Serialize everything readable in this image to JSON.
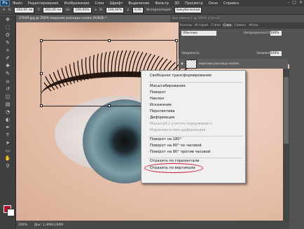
{
  "menubar": {
    "logo": "Ps",
    "items": [
      "Файл",
      "Редактирование",
      "Изображение",
      "Слои",
      "Шрифт",
      "Выделение",
      "Фильтр",
      "3D",
      "Просмотр",
      "Окно",
      "Справка"
    ],
    "win_min": "–",
    "win_max": "□",
    "win_close": "✕"
  },
  "options": {
    "x_label": "X:",
    "x_value": "162,00 пи",
    "y_label": "Y:",
    "y_value": "202,00 пи",
    "w_label": "Ш:",
    "w_value": "100,00%",
    "h_label": "В:",
    "h_value": "100,00%",
    "angle_label": "∠",
    "angle_value": "0,00",
    "interp_label": "Интерполяция:",
    "interp_value": "Бикубическая"
  },
  "tools": {
    "icons": [
      "move-icon",
      "marquee-icon",
      "lasso-icon",
      "quick-select-icon",
      "crop-icon",
      "eyedropper-icon",
      "healing-icon",
      "brush-icon",
      "stamp-icon",
      "history-brush-icon",
      "eraser-icon",
      "gradient-icon",
      "blur-icon",
      "dodge-icon",
      "pen-icon",
      "type-icon",
      "path-select-icon",
      "shape-icon",
      "hand-icon",
      "zoom-icon"
    ],
    "glyphs": [
      "✥",
      "⬚",
      "ʘ",
      "✎",
      "⌗",
      "✐",
      "✚",
      "✎",
      "⌂",
      "↺",
      "◫",
      "▤",
      "◔",
      "◐",
      "✒",
      "T",
      "➤",
      "▭",
      "✋",
      "⚲"
    ]
  },
  "document": {
    "tab": "27049.jpg @ 200% (верхние ресницы копия, RGB/8) *",
    "tab2": "Без имени-1 @ 100% (Ctrl+Z, RGB/8)"
  },
  "status": {
    "zoom": "200%",
    "doc": "Док: 1,30M/3,60M"
  },
  "panel": {
    "tabs": [
      "Каналы",
      "История",
      "Стили",
      "Слои",
      "Символ",
      "Абзац"
    ],
    "active_tab": "Слои",
    "blend_mode": "Обычные",
    "opacity_label": "Непрозрачность:",
    "opacity_value": "100%",
    "lock_label": "Закрепить:",
    "fill_label": "Заливка:",
    "fill_value": "100%",
    "layer_name": "верхние ресницы копия"
  },
  "context_menu": {
    "items": [
      {
        "label": "Свободное трансформирование",
        "disabled": false
      },
      {
        "label": "Масштабирование",
        "disabled": false
      },
      {
        "label": "Поворот",
        "disabled": false
      },
      {
        "label": "Наклон",
        "disabled": false
      },
      {
        "label": "Искажение",
        "disabled": false
      },
      {
        "label": "Перспектива",
        "disabled": false
      },
      {
        "label": "Деформация",
        "disabled": false
      },
      {
        "label": "Масштаб с учетом содержимого",
        "disabled": true
      },
      {
        "label": "Марионеточная деформация",
        "disabled": true
      },
      {
        "label": "Поворот на 180°",
        "disabled": false
      },
      {
        "label": "Поворот на 90° по часовой",
        "disabled": false
      },
      {
        "label": "Поворот на 90° против часовой",
        "disabled": false
      },
      {
        "label": "Отразить по горизонтали",
        "disabled": false
      },
      {
        "label": "Отразить по вертикали",
        "disabled": false
      }
    ]
  },
  "colors": {
    "foreground": "#b01028",
    "background": "#ffffff",
    "highlight": "#c8183c"
  }
}
